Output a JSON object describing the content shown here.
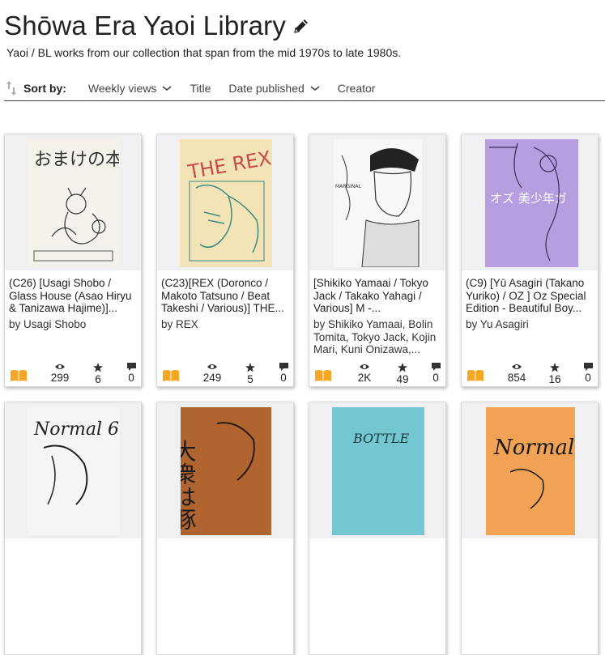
{
  "header": {
    "title": "Shōwa Era Yaoi Library",
    "edit_icon": "pencil-icon",
    "subtitle": "Yaoi / BL works from our collection that span from the mid 1970s to late 1980s."
  },
  "sort": {
    "label": "Sort by:",
    "options": [
      {
        "label": "Weekly views",
        "has_dropdown": true
      },
      {
        "label": "Title",
        "has_dropdown": false
      },
      {
        "label": "Date published",
        "has_dropdown": true
      },
      {
        "label": "Creator",
        "has_dropdown": false
      }
    ]
  },
  "colors": {
    "book_icon": "#f5a623",
    "card_cover_bg": "#f0f0f2"
  },
  "cards": [
    {
      "title": "(C26) [Usagi Shobo / Glass House (Asao Hiryu & Tanizawa Hajime)]...",
      "creator": "by Usagi Shobo",
      "views": "299",
      "stars": "6",
      "comments": "0",
      "cover_text": "おまけの本"
    },
    {
      "title": "(C23)[REX (Doronco / Makoto Tatsuno / Beat Takeshi / Various)] THE...",
      "creator": "by REX",
      "views": "249",
      "stars": "5",
      "comments": "0",
      "cover_text": "THE REX"
    },
    {
      "title": "[Shikiko Yamaai / Tokyo Jack / Takako Yahagi / Various] M -...",
      "creator": "by Shikiko Yamaai, Bolin Tomita, Tokyo Jack, Kojin Mari, Kuni Onizawa,...",
      "views": "2K",
      "stars": "49",
      "comments": "0",
      "cover_text": "MARGINAL"
    },
    {
      "title": "(C9) [Yū Asagiri (Takano Yuriko) / OZ ] Oz Special Edition - Beautiful Boy...",
      "creator": "by Yu Asagiri",
      "views": "854",
      "stars": "16",
      "comments": "0",
      "cover_text": "オズ 美少年ガ"
    },
    {
      "cover_text": "Normal 6"
    },
    {
      "cover_text": "大衆は豚"
    },
    {
      "cover_text": "BOTTLE"
    },
    {
      "cover_text": "Normal"
    }
  ]
}
